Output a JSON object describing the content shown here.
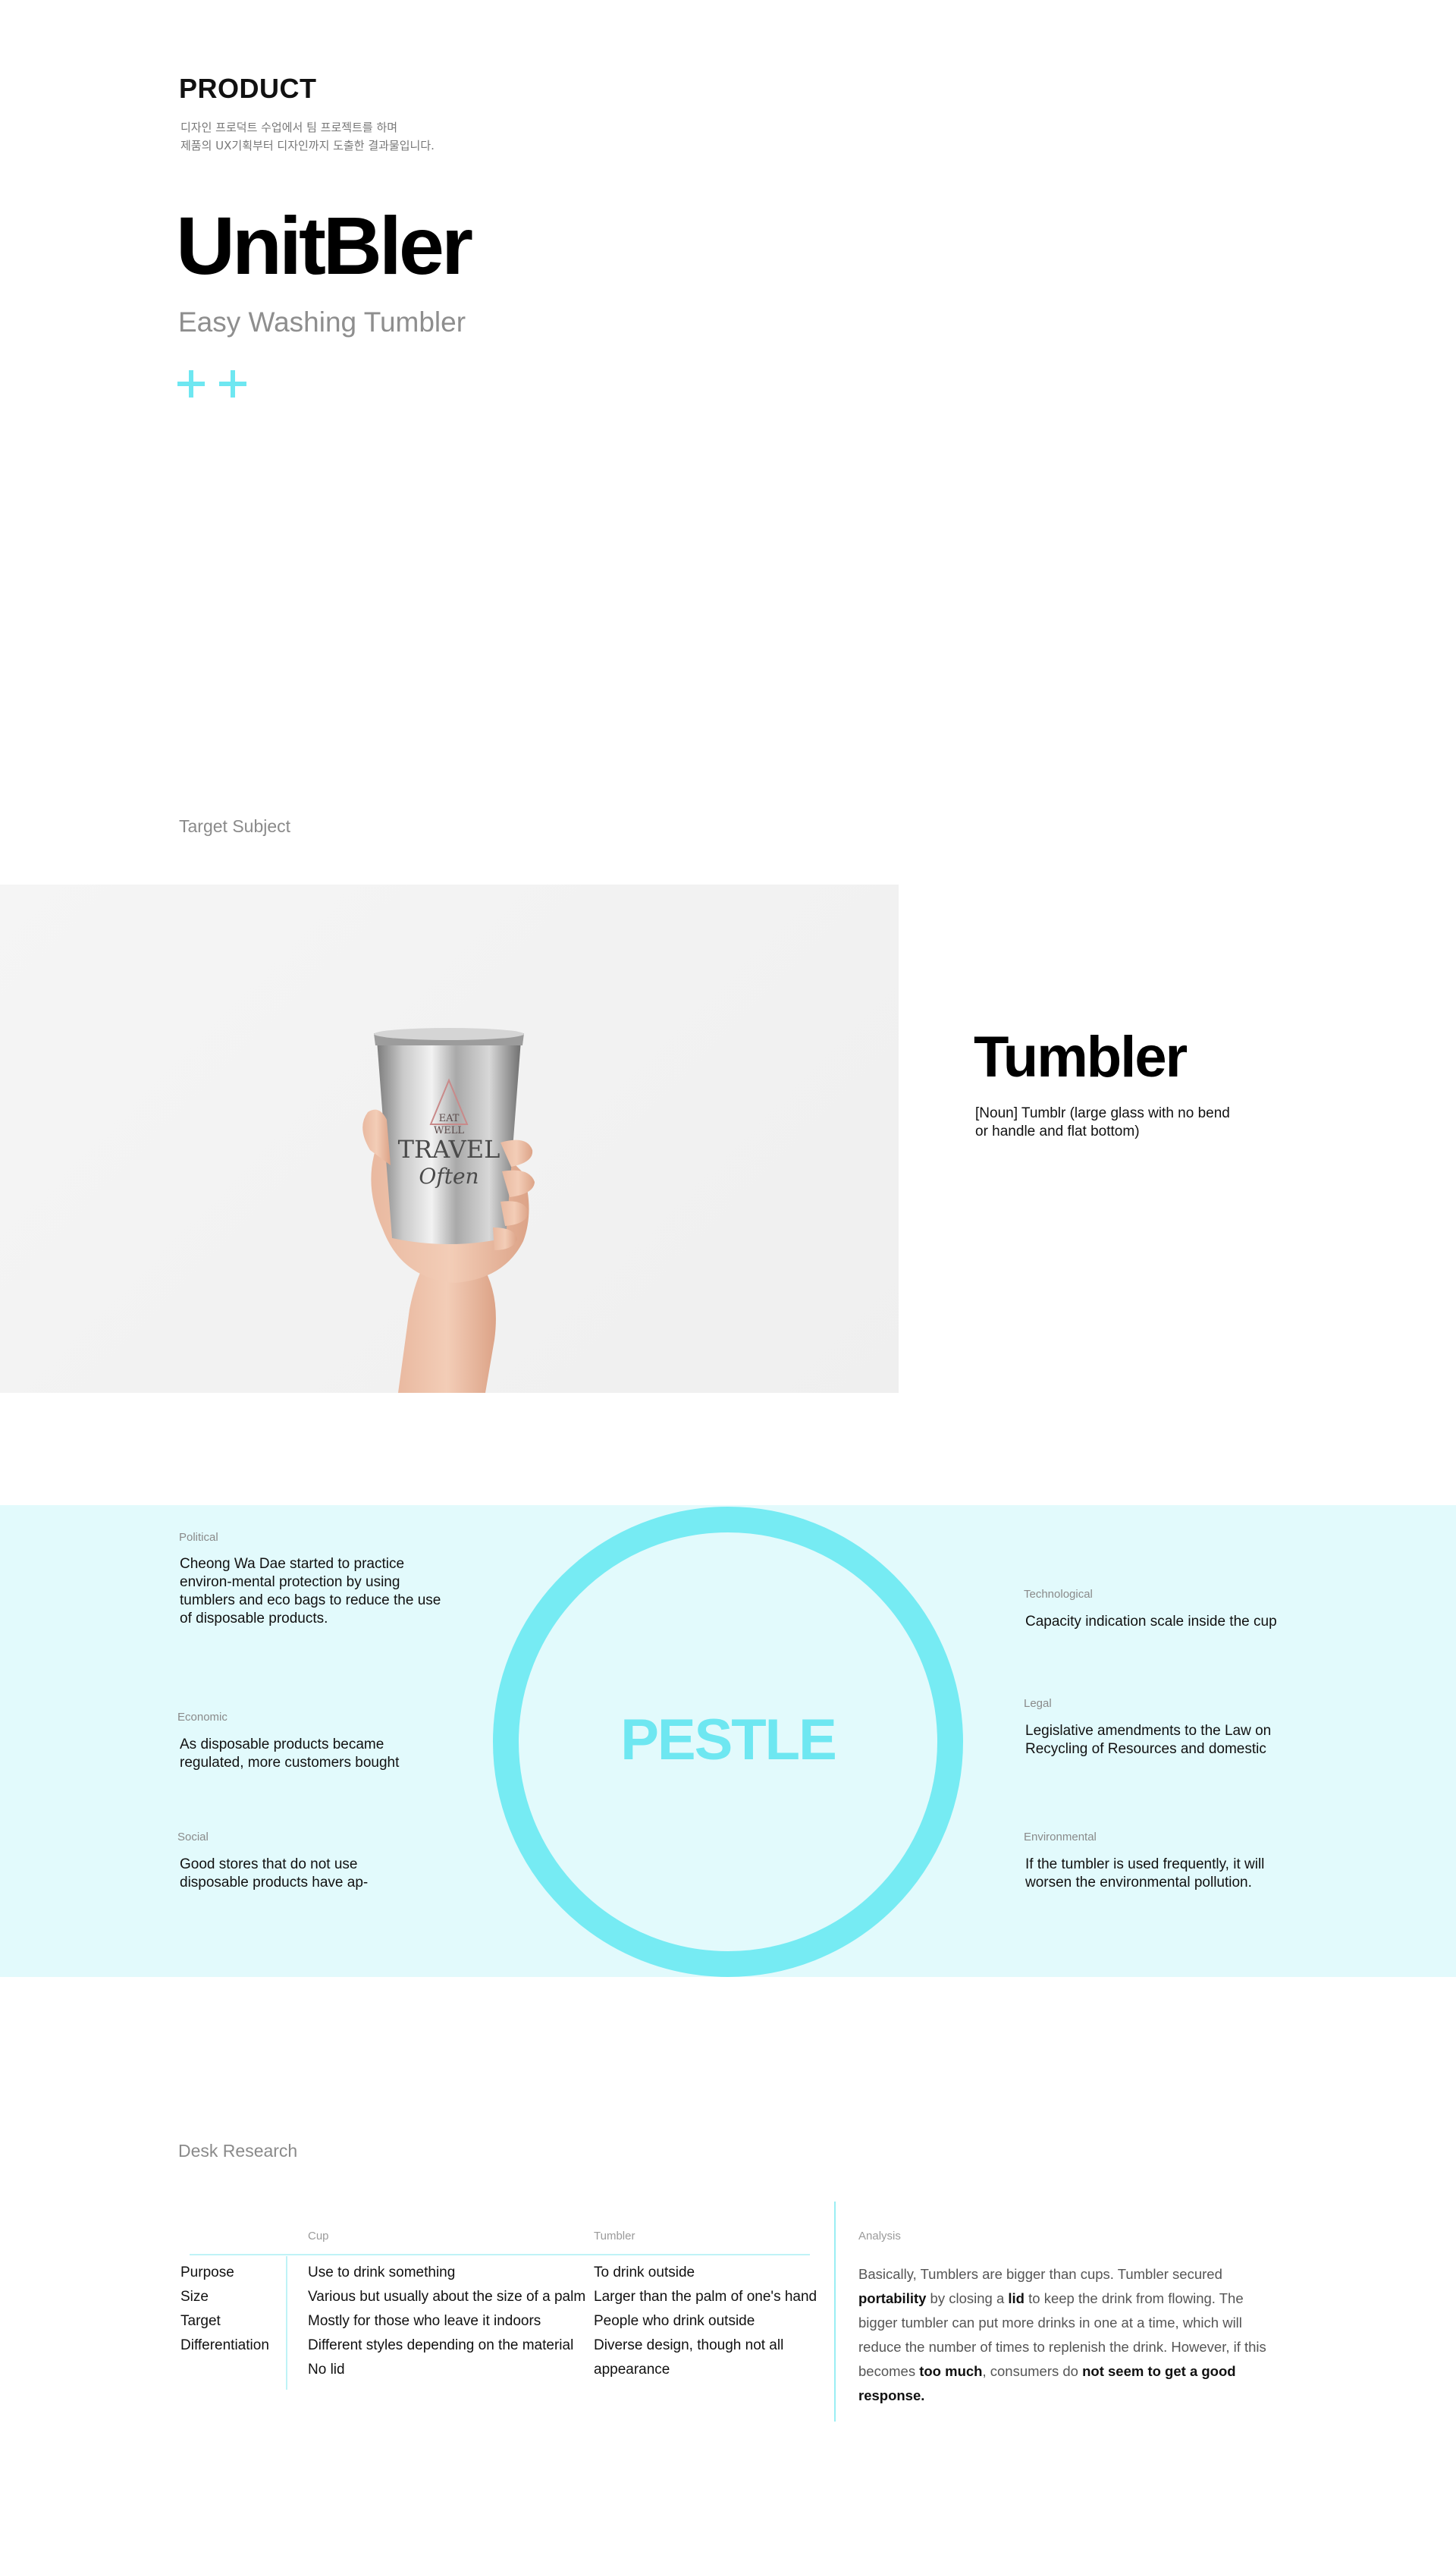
{
  "header": {
    "kicker": "PRODUCT",
    "subtitle_line1": "디자인 프로덕트 수업에서 팀 프로젝트를 하며",
    "subtitle_line2": "제품의 UX기획부터 디자인까지 도출한 결과물입니다.",
    "brand": "UnitBler",
    "tagline": "Easy Washing Tumbler",
    "plus_icons": [
      "plus-icon",
      "plus-icon"
    ],
    "accent_color": "#6ee7f1"
  },
  "target": {
    "label": "Target Subject",
    "title": "Tumbler",
    "definition": "[Noun] Tumblr (large glass with no bend or handle and flat bottom)",
    "photo_print": [
      "EAT",
      "WELL",
      "TRAVEL",
      "Often"
    ]
  },
  "pestle": {
    "title": "PESTLE",
    "band_color": "#e2fafc",
    "ring_color": "#76ebf3",
    "political": {
      "label": "Political",
      "text": "Cheong Wa Dae started to practice environ-mental protection by using tumblers and eco bags to reduce the use of disposable products."
    },
    "economic": {
      "label": "Economic",
      "text": "As disposable products became regulated, more customers bought"
    },
    "social": {
      "label": "Social",
      "text": "Good stores that do not use disposable products have ap-"
    },
    "technological": {
      "label": "Technological",
      "text": "Capacity indication scale inside the cup"
    },
    "legal": {
      "label": "Legal",
      "text": "Legislative amendments to the Law on Recycling of Resources and domestic"
    },
    "environmental": {
      "label": "Environmental",
      "text": "If the tumbler is used frequently, it will worsen the environmental pollution."
    }
  },
  "desk": {
    "label": "Desk Research",
    "columns": [
      "Cup",
      "Tumbler"
    ],
    "rows": [
      "Purpose",
      "Size",
      "Target",
      "Differentiation"
    ],
    "cup": [
      "Use to drink something",
      "Various but usually about the size of a palm",
      "Mostly for those who leave it indoors",
      "Different styles depending on the material",
      "No lid"
    ],
    "tumbler": [
      "To drink outside",
      "Larger than the palm of one's hand",
      "People who drink outside",
      "Diverse design, though not all",
      "appearance"
    ],
    "analysis": {
      "label": "Analysis",
      "t1": "Basically, Tumblers are bigger than cups. Tumbler secured ",
      "b1": "portability",
      "t2": " by closing a ",
      "b2": "lid",
      "t3": " to keep the drink from flowing. The bigger tumbler can put more drinks in one at a time, which will reduce the number of times to replenish the drink. However, if this becomes ",
      "b3": "too much",
      "t4": ", consumers do ",
      "b4": "not seem to get a good response."
    }
  }
}
